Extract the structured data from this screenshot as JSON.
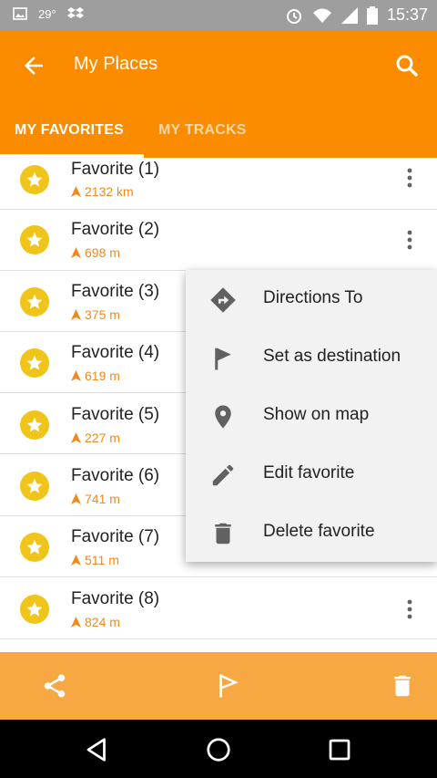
{
  "status_bar": {
    "temperature": "29°",
    "time": "15:37",
    "icons": [
      "image-icon",
      "dropbox-icon",
      "alarm-icon",
      "wifi-icon",
      "signal-icon",
      "battery-icon"
    ]
  },
  "app_bar": {
    "title": "My Places",
    "back_icon": "arrow-back-icon",
    "search_icon": "search-icon",
    "color": "#fb8c00"
  },
  "tabs": [
    {
      "label": "MY FAVORITES",
      "active": true
    },
    {
      "label": "MY TRACKS",
      "active": false
    }
  ],
  "favorites": [
    {
      "name": "Favorite (1)",
      "distance": "2132 km"
    },
    {
      "name": "Favorite (2)",
      "distance": "698 m"
    },
    {
      "name": "Favorite (3)",
      "distance": "375 m"
    },
    {
      "name": "Favorite (4)",
      "distance": "619 m"
    },
    {
      "name": "Favorite (5)",
      "distance": "227 m"
    },
    {
      "name": "Favorite (6)",
      "distance": "741 m"
    },
    {
      "name": "Favorite (7)",
      "distance": "511 m"
    },
    {
      "name": "Favorite (8)",
      "distance": "824 m"
    }
  ],
  "context_menu": {
    "items": [
      {
        "label": "Directions To",
        "icon": "directions-icon"
      },
      {
        "label": "Set as destination",
        "icon": "flag-icon"
      },
      {
        "label": "Show on map",
        "icon": "map-pin-icon"
      },
      {
        "label": "Edit favorite",
        "icon": "pencil-icon"
      },
      {
        "label": "Delete favorite",
        "icon": "trash-icon"
      }
    ]
  },
  "bottom_bar": {
    "actions": [
      "share-icon",
      "flag-outline-icon",
      "trash-icon"
    ],
    "color": "#f7a843"
  },
  "nav_bar": {
    "buttons": [
      "back-triangle-icon",
      "home-circle-icon",
      "recents-square-icon"
    ]
  },
  "colors": {
    "accent": "#fb8c00",
    "distance": "#f08a1c",
    "star": "#f0c419"
  }
}
